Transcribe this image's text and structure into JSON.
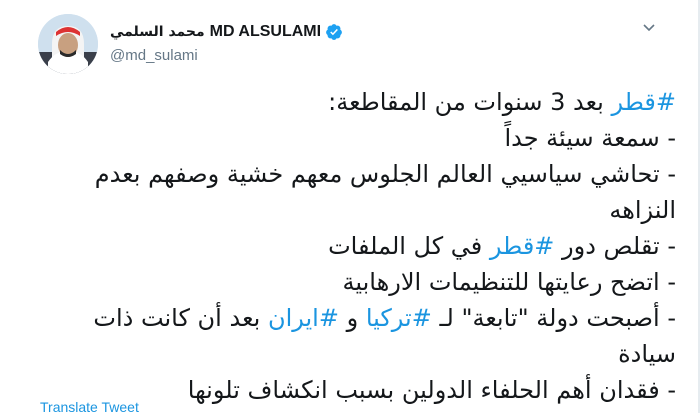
{
  "author": {
    "display_name_arabic": "محمد السلمي",
    "display_name_latin": "MD ALSULAMI",
    "handle": "@md_sulami",
    "verified": true,
    "verified_icon": "verified-badge-icon",
    "avatar_icon": "profile-photo"
  },
  "tweet": {
    "lines": [
      {
        "parts": [
          {
            "text": "#قطر",
            "hashtag": true
          },
          {
            "text": " بعد 3 سنوات من المقاطعة:",
            "hashtag": false
          }
        ]
      },
      {
        "parts": [
          {
            "text": "- سمعة سيئة جداً",
            "hashtag": false
          }
        ]
      },
      {
        "parts": [
          {
            "text": "- تحاشي سياسيي العالم الجلوس معهم خشية وصفهم بعدم النزاهه",
            "hashtag": false
          }
        ]
      },
      {
        "parts": [
          {
            "text": "- تقلص دور ",
            "hashtag": false
          },
          {
            "text": "#قطر",
            "hashtag": true
          },
          {
            "text": " في كل الملفات",
            "hashtag": false
          }
        ]
      },
      {
        "parts": [
          {
            "text": "- اتضح رعايتها للتنظيمات الارهابية",
            "hashtag": false
          }
        ]
      },
      {
        "parts": [
          {
            "text": "- أصبحت دولة \"تابعة\" لـ ",
            "hashtag": false
          },
          {
            "text": "#تركيا",
            "hashtag": true
          },
          {
            "text": " و ",
            "hashtag": false
          },
          {
            "text": "#ايران",
            "hashtag": true
          },
          {
            "text": " بعد أن كانت ذات سيادة",
            "hashtag": false
          }
        ]
      },
      {
        "parts": [
          {
            "text": "- فقدان أهم الحلفاء الدولين بسبب انكشاف تلونها",
            "hashtag": false
          }
        ]
      }
    ]
  },
  "actions": {
    "translate_label": "Translate Tweet",
    "more_icon": "chevron-down-icon"
  },
  "colors": {
    "hashtag": "#1b95e0",
    "verified": "#1da1f2",
    "secondary_text": "#657786"
  }
}
